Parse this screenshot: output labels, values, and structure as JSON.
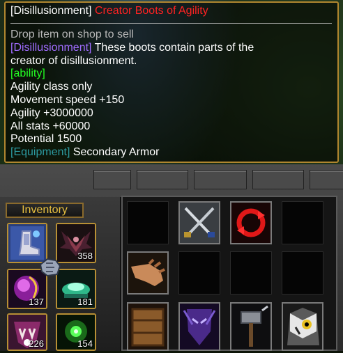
{
  "tooltip": {
    "title_prefix": "[Disillusionment]",
    "title_name": "Creator Boots of Agility",
    "hint": "Drop item on shop to sell",
    "desc_tag": "[Disillusionment]",
    "desc_line1": " These boots contain parts of the",
    "desc_line2": "creator of disillusionment.",
    "ability_tag": "[ability]",
    "stats": [
      "Agility class only",
      "Movement speed +150",
      "Agility +3000000",
      "All stats +60000",
      "Potential 1500"
    ],
    "equip_tag": "[Equipment]",
    "equip_value": " Secondary Armor"
  },
  "inventory": {
    "header": "Inventory",
    "slots": [
      {
        "icon": "boots-icon",
        "count": ""
      },
      {
        "icon": "dark-wings-icon",
        "count": "358"
      },
      {
        "icon": "purple-orb-icon",
        "count": "137"
      },
      {
        "icon": "green-potion-icon",
        "count": "181"
      },
      {
        "icon": "fang-mask-icon",
        "count": "226"
      },
      {
        "icon": "green-orb-icon",
        "count": "154"
      }
    ]
  },
  "shop": {
    "items": [
      {
        "icon": "crossed-swords-icon"
      },
      {
        "icon": "red-cycle-icon"
      },
      {
        "icon": "reaching-hand-icon"
      },
      {
        "icon": "wooden-crate-icon"
      },
      {
        "icon": "dark-elf-icon"
      },
      {
        "icon": "hammer-icon"
      },
      {
        "icon": "owl-icon"
      }
    ]
  },
  "colors": {
    "item_name": "#ff2222",
    "tag_purple": "#a06cff",
    "tag_green": "#23ff23",
    "tag_teal": "#2c9aa0",
    "border_gold": "#b0862f"
  }
}
